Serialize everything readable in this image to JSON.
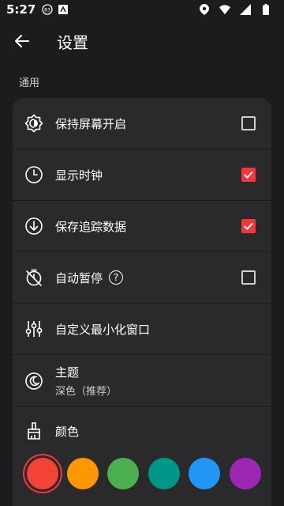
{
  "status_bar": {
    "time": "5:27",
    "badge": "83"
  },
  "app_bar": {
    "title": "设置"
  },
  "section": {
    "general_label": "通用"
  },
  "settings": {
    "keep_screen_on": {
      "label": "保持屏幕开启",
      "checked": false,
      "icon": "screen-brightness-icon"
    },
    "show_clock": {
      "label": "显示时钟",
      "checked": true,
      "icon": "clock-icon"
    },
    "save_tracking": {
      "label": "保存追踪数据",
      "checked": true,
      "icon": "download-icon"
    },
    "auto_pause": {
      "label": "自动暂停",
      "help": "?",
      "checked": false,
      "icon": "timer-off-icon"
    },
    "custom_minimize": {
      "label": "自定义最小化窗口",
      "icon": "sliders-icon"
    },
    "theme": {
      "label": "主题",
      "value": "深色（推荐）",
      "icon": "moon-icon"
    },
    "color": {
      "label": "颜色",
      "icon": "brush-icon"
    }
  },
  "color_swatches": [
    {
      "name": "red",
      "hex": "#f44336",
      "selected": true
    },
    {
      "name": "orange",
      "hex": "#ff9800",
      "selected": false
    },
    {
      "name": "green",
      "hex": "#4caf50",
      "selected": false
    },
    {
      "name": "teal",
      "hex": "#009688",
      "selected": false
    },
    {
      "name": "blue",
      "hex": "#2196f3",
      "selected": false
    },
    {
      "name": "purple",
      "hex": "#9c27b0",
      "selected": false
    }
  ],
  "accent_color": "#f0383b"
}
